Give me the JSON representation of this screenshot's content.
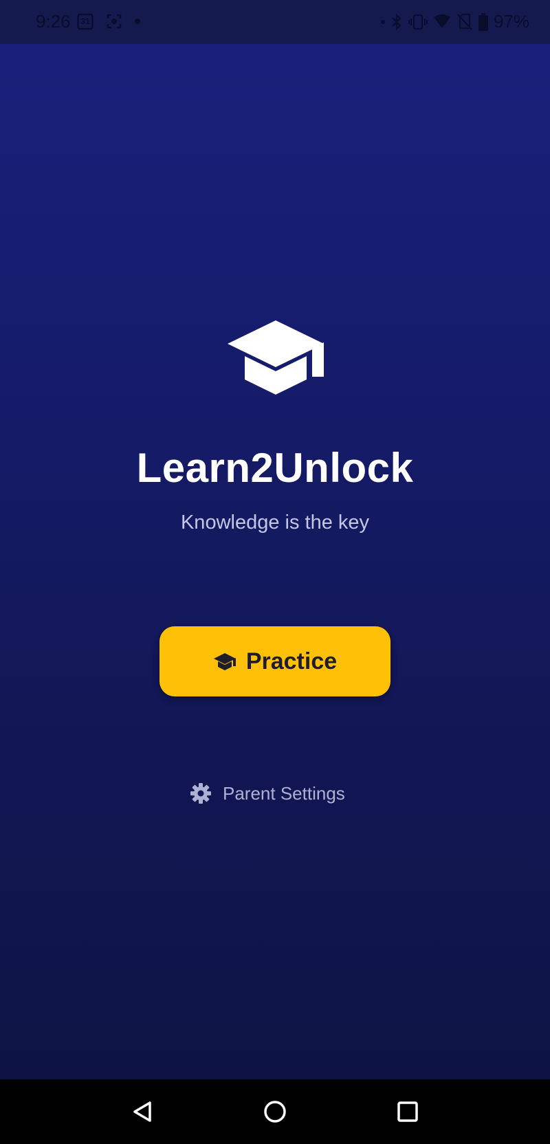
{
  "status_bar": {
    "time": "9:26",
    "calendar_day": "31",
    "battery_percent": "97%",
    "icons": [
      "calendar-icon",
      "screen-record-icon",
      "notification-dot-icon",
      "bluetooth-icon",
      "vibrate-icon",
      "wifi-icon",
      "no-sim-icon",
      "battery-icon"
    ]
  },
  "app": {
    "title": "Learn2Unlock",
    "tagline": "Knowledge is the key",
    "logo_icon": "graduation-cap-icon"
  },
  "actions": {
    "practice_label": "Practice",
    "practice_icon": "graduation-cap-icon",
    "settings_label": "Parent Settings",
    "settings_icon": "gear-icon"
  },
  "colors": {
    "background_top": "#19207a",
    "background_bottom": "#0e1344",
    "accent": "#ffc107",
    "title_text": "#ffffff",
    "tagline_text": "#c4c7e6"
  },
  "nav_bar": {
    "icons": [
      "back-icon",
      "home-icon",
      "recents-icon"
    ]
  }
}
